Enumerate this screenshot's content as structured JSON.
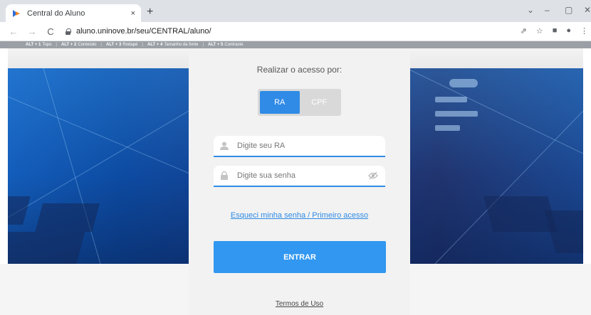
{
  "browser": {
    "tab_title": "Central do Aluno",
    "tab_close": "×",
    "new_tab": "+",
    "url": "aluno.uninove.br/seu/CENTRAL/aluno/",
    "window_controls": [
      "⌄",
      "–",
      "▢",
      "✕"
    ],
    "toolbar_icons": [
      "share-icon",
      "star-icon",
      "sidebar-icon",
      "profile-icon",
      "menu-icon"
    ]
  },
  "accessibility_bar": {
    "items": [
      {
        "key": "ALT + 1",
        "label": "Topo"
      },
      {
        "key": "ALT + 2",
        "label": "Conteúdo"
      },
      {
        "key": "ALT + 3",
        "label": "Rodapé"
      },
      {
        "key": "ALT + 4",
        "label": "Tamanho da fonte"
      },
      {
        "key": "ALT + 5",
        "label": "Contraste"
      }
    ]
  },
  "login": {
    "title": "Realizar o acesso por:",
    "toggle": {
      "option_ra": "RA",
      "option_cpf": "CPF",
      "selected": "RA"
    },
    "ra_placeholder": "Digite seu RA",
    "password_placeholder": "Digite sua senha",
    "forgot_link": "Esqueci minha senha / Primeiro acesso",
    "submit_label": "ENTRAR",
    "terms_link": "Termos de Uso"
  },
  "colors": {
    "accent": "#3197f0",
    "hero_blue": "#1463c3"
  }
}
